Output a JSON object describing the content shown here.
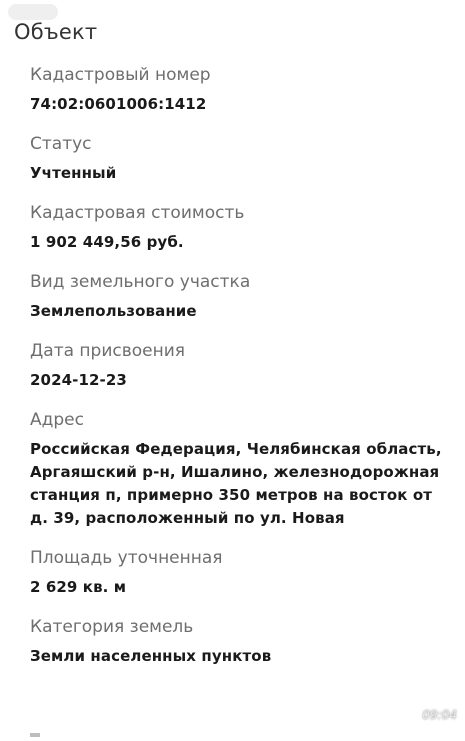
{
  "header": {
    "title": "Объект"
  },
  "fields": [
    {
      "label": "Кадастровый номер",
      "value": "74:02:0601006:1412"
    },
    {
      "label": "Статус",
      "value": "Учтенный"
    },
    {
      "label": "Кадастровая стоимость",
      "value": "1 902 449,56 руб."
    },
    {
      "label": "Вид земельного участка",
      "value": "Землепользование"
    },
    {
      "label": "Дата присвоения",
      "value": "2024-12-23"
    },
    {
      "label": "Адрес",
      "value": "Российская Федерация, Челябинская область, Аргаяшский р-н, Ишалино, железнодорожная станция п, примерно 350 метров на восток от д. 39, расположенный по ул. Новая"
    },
    {
      "label": "Площадь уточненная",
      "value": "2 629 кв. м"
    },
    {
      "label": "Категория земель",
      "value": "Земли населенных пунктов"
    }
  ],
  "overlay": {
    "clock": "09:04"
  }
}
